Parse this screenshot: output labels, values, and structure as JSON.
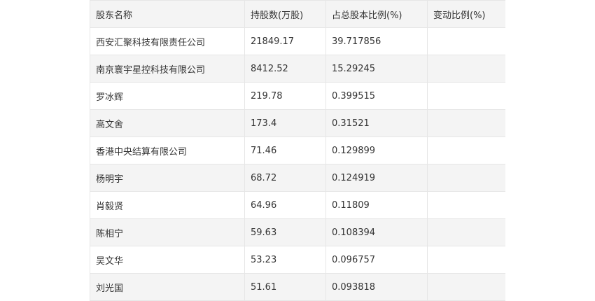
{
  "table": {
    "headers": [
      "股东名称",
      "持股数(万股)",
      "占总股本比例(%)",
      "变动比例(%)"
    ],
    "rows": [
      [
        "西安汇聚科技有限责任公司",
        "21849.17",
        "39.717856",
        ""
      ],
      [
        "南京寰宇星控科技有限公司",
        "8412.52",
        "15.29245",
        ""
      ],
      [
        "罗冰辉",
        "219.78",
        "0.399515",
        ""
      ],
      [
        "高文舍",
        "173.4",
        "0.31521",
        ""
      ],
      [
        "香港中央结算有限公司",
        "71.46",
        "0.129899",
        ""
      ],
      [
        "杨明宇",
        "68.72",
        "0.124919",
        ""
      ],
      [
        "肖毅贤",
        "64.96",
        "0.11809",
        ""
      ],
      [
        "陈相宁",
        "59.63",
        "0.108394",
        ""
      ],
      [
        "吴文华",
        "53.23",
        "0.096757",
        ""
      ],
      [
        "刘光国",
        "51.61",
        "0.093818",
        ""
      ]
    ]
  }
}
